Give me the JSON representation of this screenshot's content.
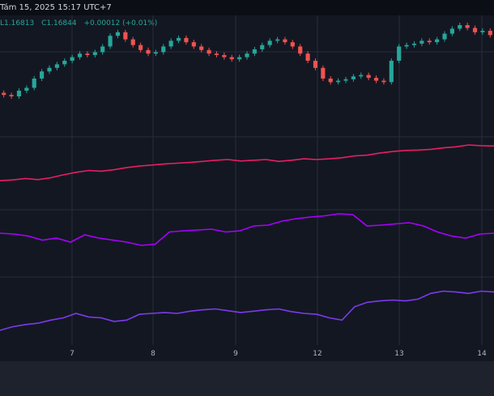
{
  "header": {
    "date_text": "Tám 15, 2025 15:17 UTC+7",
    "ohlc_low": "L1.16813",
    "ohlc_close": "C1.16844",
    "ohlc_change": "+0.00012 (+0.01%)"
  },
  "colors": {
    "background": "#131722",
    "grid": "#2a2e39",
    "candle_up": "#26a69a",
    "candle_down": "#ef5350",
    "line_magenta": "#e91e63",
    "line_purple": "#aa00ff",
    "line_violet": "#7c3aed"
  },
  "chart_data": {
    "type": "line",
    "x_ticks": [
      "7",
      "8",
      "9",
      "12",
      "13",
      "14"
    ],
    "series": [
      {
        "kind": "candles",
        "values": [
          0.05,
          0.02,
          0.0,
          0.08,
          0.12,
          0.25,
          0.35,
          0.4,
          0.45,
          0.5,
          0.55,
          0.6,
          0.58,
          0.62,
          0.7,
          0.85,
          0.9,
          0.8,
          0.72,
          0.65,
          0.6,
          0.62,
          0.7,
          0.78,
          0.82,
          0.76,
          0.7,
          0.65,
          0.6,
          0.58,
          0.55,
          0.52,
          0.55,
          0.6,
          0.66,
          0.72,
          0.78,
          0.8,
          0.76,
          0.7,
          0.6,
          0.5,
          0.4,
          0.25,
          0.2,
          0.22,
          0.24,
          0.28,
          0.3,
          0.26,
          0.22,
          0.2,
          0.5,
          0.7,
          0.72,
          0.74,
          0.78,
          0.76,
          0.8,
          0.88,
          0.95,
          1.0,
          0.96,
          0.9,
          0.92,
          0.86
        ]
      },
      {
        "kind": "line",
        "color": "line_magenta",
        "values": [
          0.02,
          0.04,
          0.08,
          0.05,
          0.1,
          0.18,
          0.25,
          0.3,
          0.28,
          0.32,
          0.38,
          0.42,
          0.45,
          0.48,
          0.5,
          0.52,
          0.55,
          0.58,
          0.6,
          0.56,
          0.58,
          0.6,
          0.55,
          0.58,
          0.62,
          0.6,
          0.62,
          0.65,
          0.7,
          0.72,
          0.78,
          0.82,
          0.85,
          0.86,
          0.88,
          0.92,
          0.95,
          1.0,
          0.98,
          0.97
        ]
      },
      {
        "kind": "line",
        "color": "line_purple",
        "values": [
          0.52,
          0.5,
          0.45,
          0.35,
          0.4,
          0.3,
          0.48,
          0.4,
          0.35,
          0.3,
          0.22,
          0.25,
          0.55,
          0.58,
          0.6,
          0.62,
          0.55,
          0.58,
          0.7,
          0.72,
          0.82,
          0.88,
          0.92,
          0.95,
          1.0,
          0.98,
          0.7,
          0.72,
          0.75,
          0.78,
          0.7,
          0.55,
          0.45,
          0.4,
          0.5,
          0.52
        ]
      },
      {
        "kind": "line",
        "color": "line_violet",
        "values": [
          0.02,
          0.1,
          0.15,
          0.18,
          0.25,
          0.3,
          0.4,
          0.32,
          0.3,
          0.22,
          0.25,
          0.38,
          0.4,
          0.42,
          0.4,
          0.45,
          0.48,
          0.5,
          0.46,
          0.42,
          0.45,
          0.48,
          0.5,
          0.44,
          0.4,
          0.38,
          0.3,
          0.25,
          0.55,
          0.65,
          0.68,
          0.7,
          0.68,
          0.72,
          0.85,
          0.9,
          0.88,
          0.85,
          0.9,
          0.88
        ]
      }
    ]
  }
}
